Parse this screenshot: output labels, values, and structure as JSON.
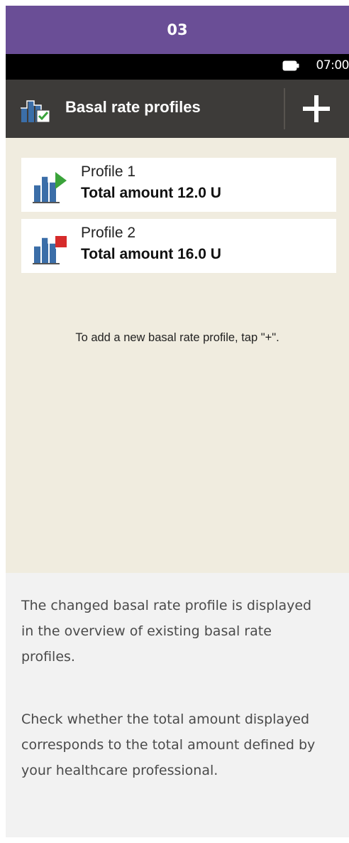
{
  "step": {
    "number": "03"
  },
  "statusbar": {
    "time": "07:00",
    "battery_icon": "battery-icon"
  },
  "titlebar": {
    "title": "Basal rate profiles",
    "title_icon": "basal-profile-check-icon",
    "add_icon": "plus-icon"
  },
  "profiles": [
    {
      "name": "Profile 1",
      "total": "Total amount 12.0 U",
      "status_icon": "play-icon",
      "status_color": "#3aa33a"
    },
    {
      "name": "Profile 2",
      "total": "Total amount 16.0 U",
      "status_icon": "stop-icon",
      "status_color": "#d62b2b"
    }
  ],
  "hint": "To add a new basal rate profile, tap \"+\".",
  "captions": [
    "The changed basal rate profile is displayed in the overview of existing basal rate profiles.",
    "Check whether the total amount displayed corresponds to the total amount defined by your healthcare professional."
  ],
  "colors": {
    "header_purple": "#6a4e96",
    "titlebar": "#3d3b39",
    "screen_bg": "#f0ecdf",
    "icon_blue": "#3b6ea8",
    "check_green": "#3aa33a"
  }
}
